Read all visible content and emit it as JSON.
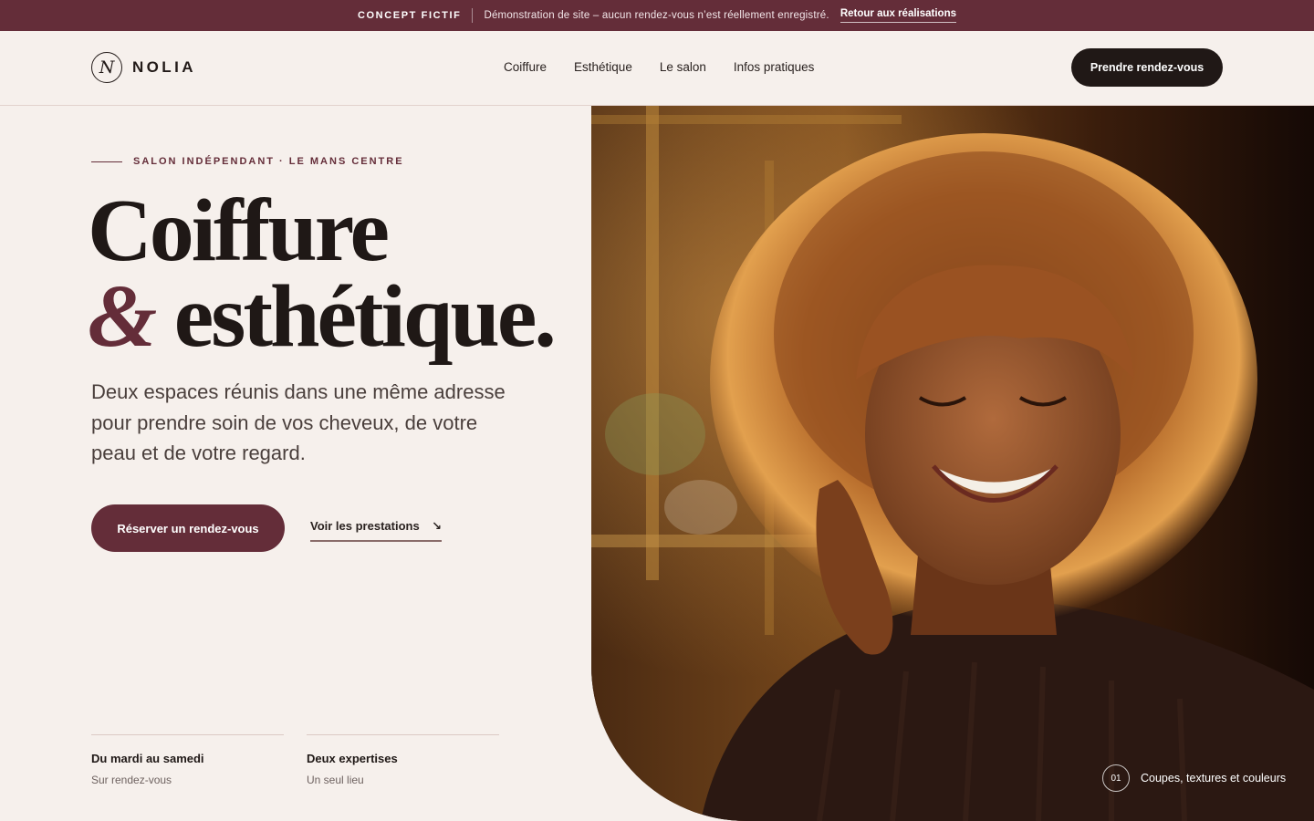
{
  "banner": {
    "tag": "CONCEPT FICTIF",
    "message": "Démonstration de site – aucun rendez-vous n’est réellement enregistré.",
    "back_link": "Retour aux réalisations"
  },
  "header": {
    "logo_letter": "N",
    "logo_text": "NOLIA",
    "nav": [
      "Coiffure",
      "Esthétique",
      "Le salon",
      "Infos pratiques"
    ],
    "cta": "Prendre rendez-vous"
  },
  "hero": {
    "eyebrow": "SALON INDÉPENDANT · LE MANS CENTRE",
    "title_line1": "Coiffure",
    "title_amp": "&",
    "title_line2": "esthétique.",
    "lead": "Deux espaces réunis dans une même adresse pour prendre soin de vos cheveux, de votre peau et de votre regard.",
    "primary_button": "Réserver un rendez-vous",
    "secondary_link": "Voir les prestations",
    "secondary_arrow": "↘",
    "features": [
      {
        "title": "Du mardi au samedi",
        "subtitle": "Sur rendez-vous"
      },
      {
        "title": "Deux expertises",
        "subtitle": "Un seul lieu"
      }
    ],
    "image_caption": {
      "number": "01",
      "text": "Coupes, textures et couleurs"
    }
  },
  "colors": {
    "brand": "#642d39",
    "dark": "#201816",
    "background": "#f6f0ec"
  }
}
